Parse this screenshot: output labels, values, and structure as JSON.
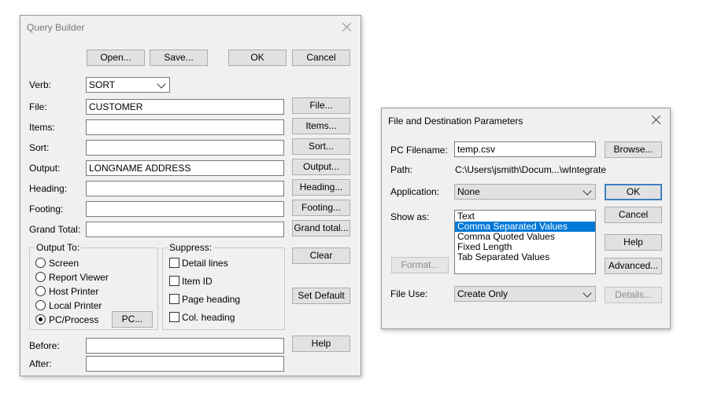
{
  "qb": {
    "title": "Query Builder",
    "open_label": "Open...",
    "save_label": "Save...",
    "ok_label": "OK",
    "cancel_label": "Cancel",
    "verb_label": "Verb:",
    "verb_value": "SORT",
    "fields": [
      {
        "label": "File:",
        "value": "CUSTOMER",
        "button": "File..."
      },
      {
        "label": "Items:",
        "value": "",
        "button": "Items..."
      },
      {
        "label": "Sort:",
        "value": "",
        "button": "Sort..."
      },
      {
        "label": "Output:",
        "value": "LONGNAME ADDRESS",
        "button": "Output..."
      },
      {
        "label": "Heading:",
        "value": "",
        "button": "Heading..."
      },
      {
        "label": "Footing:",
        "value": "",
        "button": "Footing..."
      },
      {
        "label": "Grand Total:",
        "value": "",
        "button": "Grand total..."
      }
    ],
    "output_to": {
      "title": "Output To:",
      "options": [
        "Screen",
        "Report Viewer",
        "Host Printer",
        "Local Printer",
        "PC/Process"
      ],
      "selected": "PC/Process",
      "pc_button": "PC..."
    },
    "suppress": {
      "title": "Suppress:",
      "options": [
        "Detail lines",
        "Item ID",
        "Page heading",
        "Col. heading"
      ]
    },
    "clear_label": "Clear",
    "set_default_label": "Set Default",
    "help_label": "Help",
    "before_label": "Before:",
    "before_value": "",
    "after_label": "After:",
    "after_value": ""
  },
  "fdp": {
    "title": "File and Destination Parameters",
    "pc_filename_label": "PC Filename:",
    "pc_filename_value": "temp.csv",
    "browse_label": "Browse...",
    "path_label": "Path:",
    "path_value": "C:\\Users\\jsmith\\Docum...\\wIntegrate",
    "application_label": "Application:",
    "application_value": "None",
    "ok_label": "OK",
    "cancel_label": "Cancel",
    "show_as_label": "Show as:",
    "show_as_options": [
      "Text",
      "Comma Separated Values",
      "Comma Quoted Values",
      "Fixed Length",
      "Tab Separated Values"
    ],
    "show_as_selected": "Comma Separated Values",
    "help_label": "Help",
    "format_label": "Format...",
    "advanced_label": "Advanced...",
    "file_use_label": "File Use:",
    "file_use_value": "Create Only",
    "details_label": "Details..."
  }
}
